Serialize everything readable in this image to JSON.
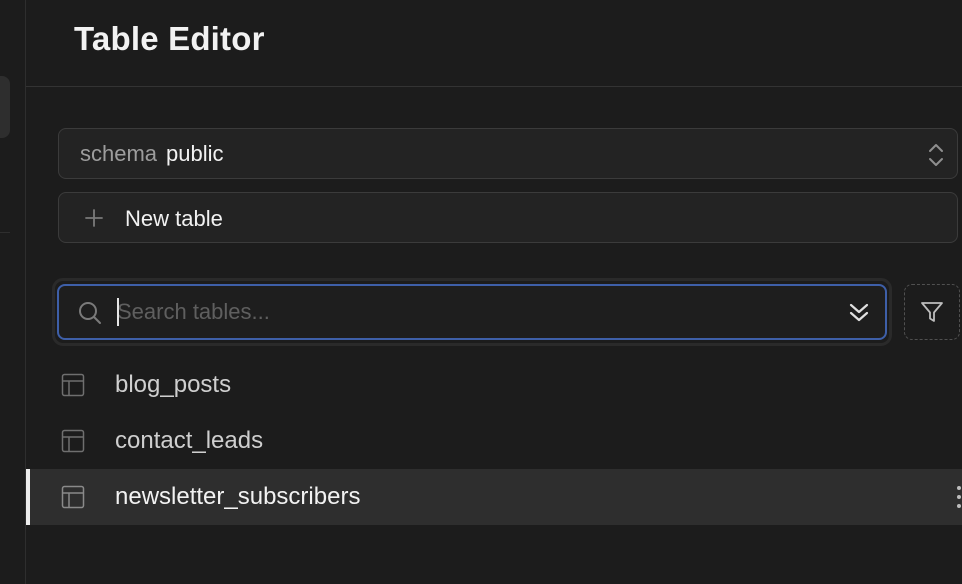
{
  "header": {
    "title": "Table Editor"
  },
  "schema": {
    "prefix": "schema",
    "value": "public"
  },
  "new_table": {
    "label": "New table"
  },
  "search": {
    "placeholder": "Search tables...",
    "value": ""
  },
  "tables": [
    {
      "name": "blog_posts",
      "active": false
    },
    {
      "name": "contact_leads",
      "active": false
    },
    {
      "name": "newsletter_subscribers",
      "active": true
    }
  ],
  "icons": {
    "schema_chevron": "chevron-up-down-icon",
    "new_table": "plus-icon",
    "search": "search-icon",
    "collapse": "chevrons-down-icon",
    "filter": "filter-icon",
    "table": "table-icon",
    "more": "more-vertical-icon"
  },
  "colors": {
    "background": "#1c1c1c",
    "control_bg": "#232323",
    "border": "#3b3b3b",
    "focus_ring": "#3e5fa8",
    "active_row": "#2e2e2e",
    "text_primary": "#f2f2f2",
    "text_muted": "#9d9d9d"
  }
}
